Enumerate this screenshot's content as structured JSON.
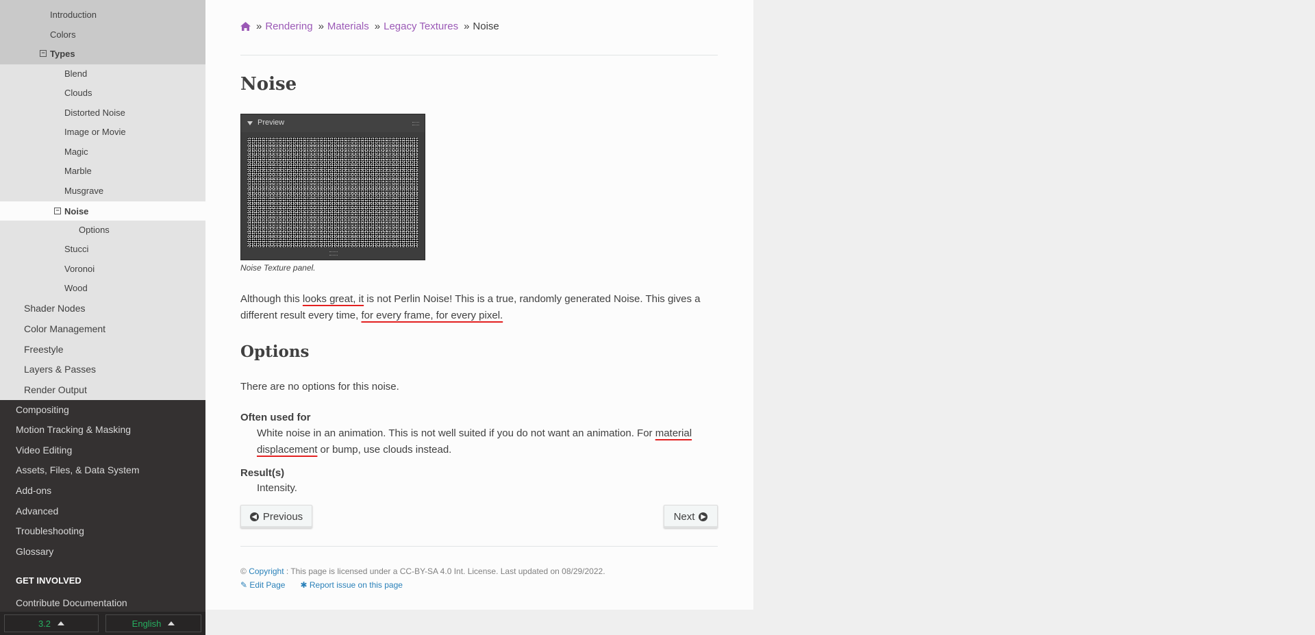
{
  "sidebar": {
    "level3_items": [
      "Introduction",
      "Colors",
      "Types"
    ],
    "level4_items": [
      "Blend",
      "Clouds",
      "Distorted Noise",
      "Image or Movie",
      "Magic",
      "Marble",
      "Musgrave"
    ],
    "current": "Noise",
    "current_child": "Options",
    "level4_after": [
      "Stucci",
      "Voronoi",
      "Wood"
    ],
    "level2_items": [
      "Shader Nodes",
      "Color Management",
      "Freestyle",
      "Layers & Passes",
      "Render Output"
    ],
    "level1_items": [
      "Compositing",
      "Motion Tracking & Masking",
      "Video Editing",
      "Assets, Files, & Data System",
      "Add-ons",
      "Advanced",
      "Troubleshooting",
      "Glossary"
    ],
    "section_caption": "GET INVOLVED",
    "contribute": "Contribute Documentation",
    "version": "3.2",
    "language": "English"
  },
  "breadcrumb": {
    "home_icon": "home-icon",
    "items": [
      "Rendering",
      "Materials",
      "Legacy Textures"
    ],
    "current": "Noise",
    "separator": "»"
  },
  "page": {
    "title": "Noise",
    "figure": {
      "panel_title": "Preview",
      "caption": "Noise Texture panel."
    },
    "intro": {
      "s1": "Although this ",
      "s2": "looks great, it",
      "s3": " is not Perlin Noise! This is a true, randomly generated Noise. This gives a different result every time, ",
      "s4": "for every frame, for every pixel."
    },
    "options_heading": "Options",
    "options_text": "There are no options for this noise.",
    "often_used_label": "Often used for",
    "often_used": {
      "s1": "White noise in an animation. This is not well suited if you do not want an animation. For ",
      "s2": "material displacement",
      "s3": " or bump, use clouds instead."
    },
    "results_label": "Result(s)",
    "results_text": "Intensity."
  },
  "nav_buttons": {
    "previous": "Previous",
    "next": "Next"
  },
  "footer": {
    "copyright_symbol": "©",
    "copyright_link": "Copyright",
    "license_text": ": This page is licensed under a CC-BY-SA 4.0 Int. License. Last updated on 08/29/2022.",
    "edit_page": "Edit Page",
    "report_issue": "Report issue on this page"
  },
  "colors": {
    "link_visited": "#9b59b6",
    "link_blue": "#2980b9",
    "sidebar_dark": "#343131",
    "version_green": "#27ae60",
    "annotation_red": "#e32020"
  }
}
